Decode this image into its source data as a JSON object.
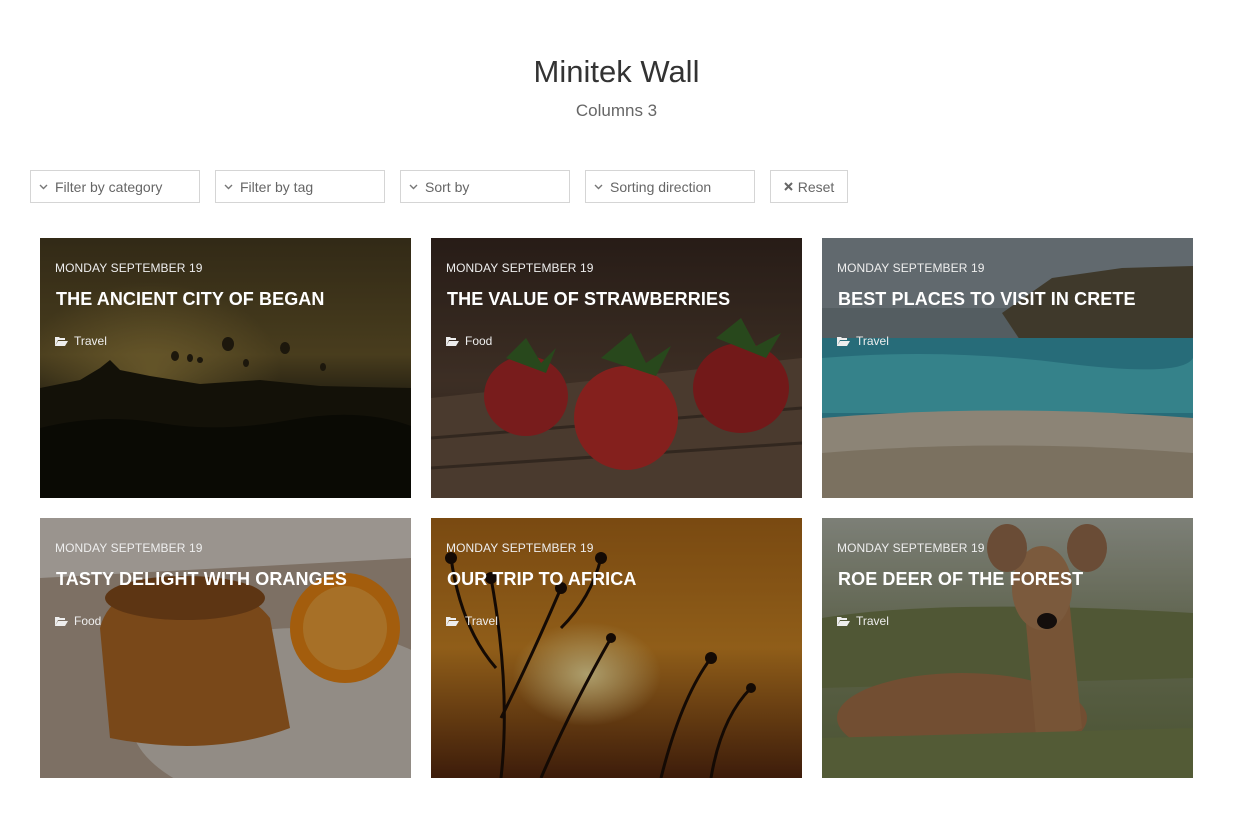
{
  "header": {
    "title": "Minitek Wall",
    "subtitle": "Columns 3"
  },
  "filters": {
    "category": "Filter by category",
    "tag": "Filter by tag",
    "sort": "Sort by",
    "direction": "Sorting direction",
    "reset": "Reset"
  },
  "cards": [
    {
      "date": "MONDAY SEPTEMBER 19",
      "title": "THE ANCIENT CITY OF BEGAN",
      "category": "Travel"
    },
    {
      "date": "MONDAY SEPTEMBER 19",
      "title": "THE VALUE OF STRAWBERRIES",
      "category": "Food"
    },
    {
      "date": "MONDAY SEPTEMBER 19",
      "title": "BEST PLACES TO VISIT IN CRETE",
      "category": "Travel"
    },
    {
      "date": "MONDAY SEPTEMBER 19",
      "title": "TASTY DELIGHT WITH ORANGES",
      "category": "Food"
    },
    {
      "date": "MONDAY SEPTEMBER 19",
      "title": "OUR TRIP TO AFRICA",
      "category": "Travel"
    },
    {
      "date": "MONDAY SEPTEMBER 19",
      "title": "ROE DEER OF THE FOREST",
      "category": "Travel"
    }
  ],
  "icons": {
    "dropdown": "chevron-down-icon",
    "reset": "close-icon",
    "category": "folder-open-icon"
  }
}
